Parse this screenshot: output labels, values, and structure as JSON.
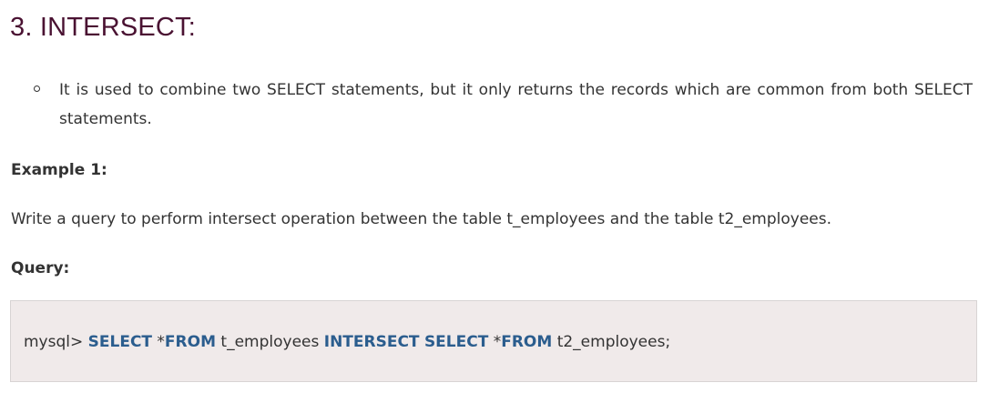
{
  "heading": "3. INTERSECT:",
  "bullets": [
    "It is used to combine two SELECT statements, but it only returns the records which are common from both SELECT statements."
  ],
  "example_label": "Example 1:",
  "description": "Write a query to perform intersect operation between the table t_employees and the table t2_employees.",
  "query_label": "Query:",
  "code": {
    "prompt": "mysql> ",
    "kw_select_1": "SELECT",
    "star_1": " *",
    "kw_from_1": "FROM",
    "table_1": " t_employees ",
    "kw_intersect": "INTERSECT",
    "space": " ",
    "kw_select_2": "SELECT",
    "star_2": " *",
    "kw_from_2": "FROM",
    "table_2": " t2_employees;"
  },
  "colors": {
    "heading": "#4a1232",
    "keyword": "#2b5d8e",
    "code_background": "#f0eaea",
    "text": "#333333"
  }
}
